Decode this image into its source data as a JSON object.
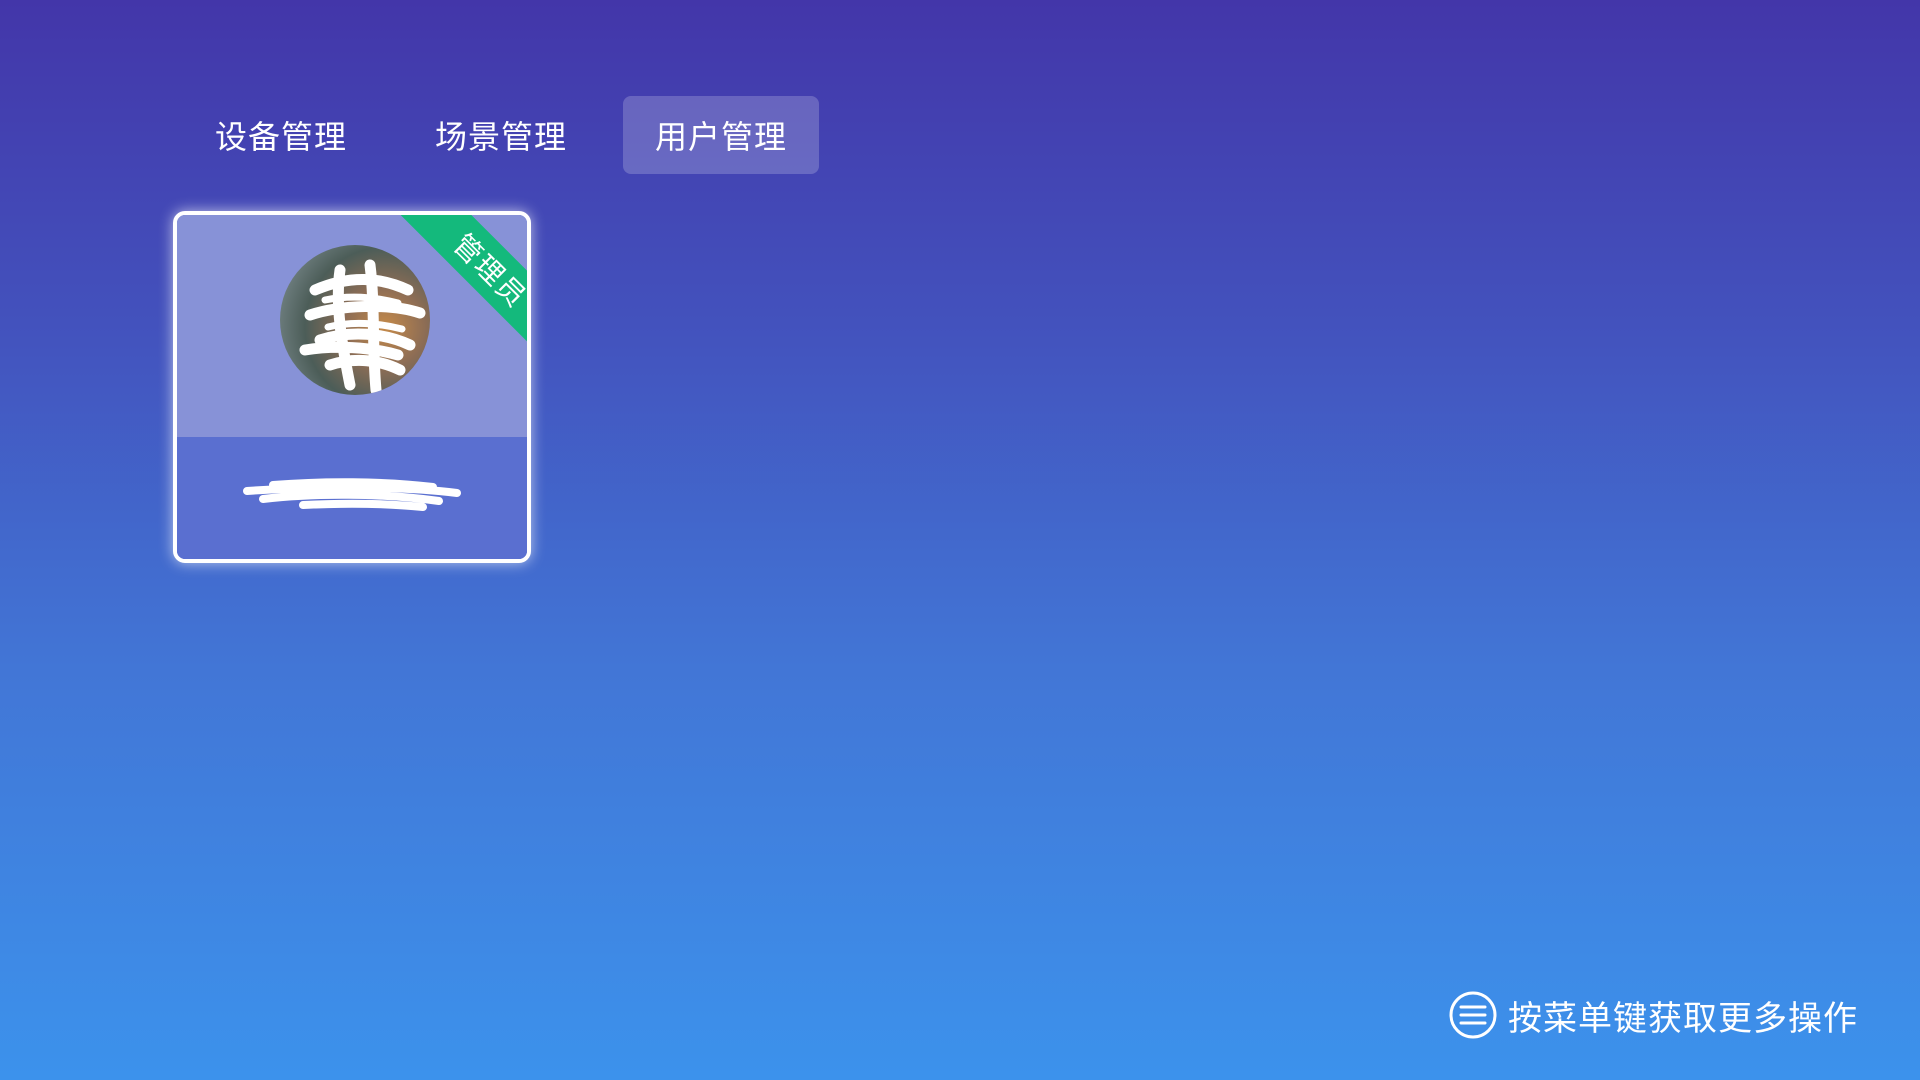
{
  "tabs": [
    {
      "label": "设备管理",
      "active": false
    },
    {
      "label": "场景管理",
      "active": false
    },
    {
      "label": "用户管理",
      "active": true
    }
  ],
  "user_card": {
    "badge": "管理员",
    "avatar": "avatar-image",
    "name": ""
  },
  "hint": {
    "icon": "menu-icon",
    "text": "按菜单键获取更多操作"
  },
  "colors": {
    "background_top": "#4336a9",
    "background_bottom": "#3c92ec",
    "badge_green": "#14b97c",
    "card_top": "#8792d7",
    "card_bottom": "#5a6fd0"
  }
}
